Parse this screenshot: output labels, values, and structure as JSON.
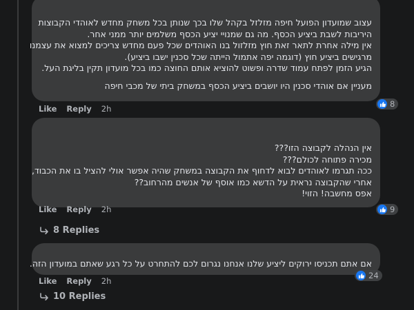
{
  "comments": [
    {
      "lines": [
        "עצוב שמועדון הפועל חיפה מזלזל בקהל שלו בכך שנותן בכל משחק מחדש לאוהדי הקבוצות",
        "היריבות לשבת ביציע הכסף. מה גם שמנויי יציע הכסף משלמים יותר ממני אחר.",
        "אין מילה אחרת לתאר זאת חוץ מזלזול בנו האוהדים שכל פעם מחדש צריכים למצוא את עצמנו",
        "מרגישים ביציע חוץ (דוגמה יפה אתמול הייתה שכל סכנין ישבו ביציע).",
        "הגיע הזמן לפתח עמוד שדרה ופשוט להוציא אותם החוצה כמו בכל מועדון תקין בליגת העל."
      ],
      "extra_line": "מעניין אם אוהדי סכנין היו יושבים ביציע הכסף במשחק ביתי של מכבי חיפה",
      "like_label": "Like",
      "reply_label": "Reply",
      "time": "2h",
      "reaction_count": "8"
    },
    {
      "lines": [
        "אין הנהלה לקבוצה הזו???",
        "מכירה פתוחה לכולם???",
        "ככה תגרמו לאוהדים לבוא לדחוף את הקבוצה במשחק שהיה אפשר אולי להציל בו את הכבוד,",
        "אחרי שהקבוצה נראית על הדשא כמו אוסף של אנשים מהרחוב??",
        "אפס מחשבה! הזוי!"
      ],
      "like_label": "Like",
      "reply_label": "Reply",
      "time": "2h",
      "reaction_count": "9",
      "replies_label": "8 Replies"
    },
    {
      "lines": [
        "אם אתם תכניסו ירוקים ליציע שלנו אנחנו נגרום לכם להתחרט על כל רגע שאתם במועדון הזה."
      ],
      "like_label": "Like",
      "reply_label": "Reply",
      "time": "2h",
      "reaction_count": "24",
      "replies_label": "10 Replies"
    }
  ],
  "colors": {
    "background": "#18191a",
    "bubble": "#3a3b3c",
    "text": "#e4e6eb",
    "muted": "#b0b3b8",
    "like_blue": "#1877f2"
  },
  "icons": {
    "reaction": "thumbs-up-icon",
    "replies": "reply-arrow-icon"
  }
}
